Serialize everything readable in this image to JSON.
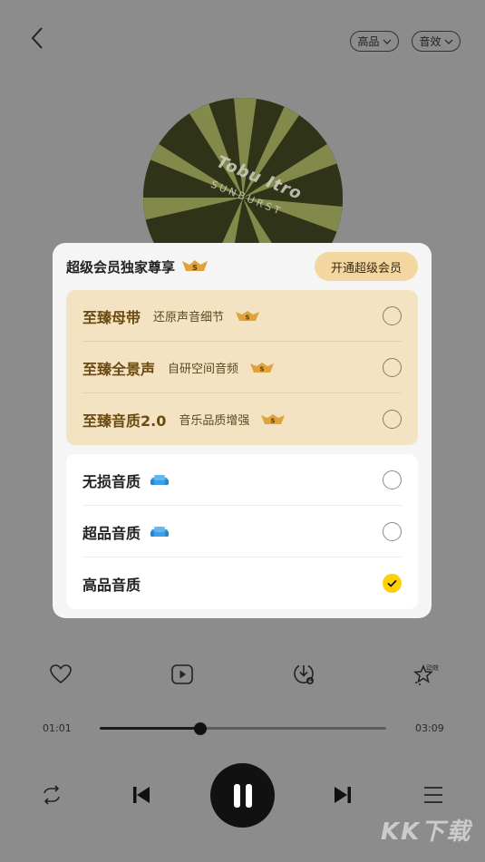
{
  "top_bar": {
    "back_icon": "chevron-left-icon",
    "quality_label": "高品",
    "effect_label": "音效"
  },
  "album": {
    "brand_text": "Tobu Itro",
    "sub_text": "SUNBURST"
  },
  "modal": {
    "title": "超级会员独家尊享",
    "title_badge": "super-vip-s-badge",
    "open_button": "开通超级会员",
    "premium_options": [
      {
        "name": "至臻母带",
        "desc": "还原声音细节",
        "badge": "super-vip-s-badge",
        "selected": false
      },
      {
        "name": "至臻全景声",
        "desc": "自研空间音频",
        "badge": "super-vip-s-badge",
        "selected": false
      },
      {
        "name": "至臻音质2.0",
        "desc": "音乐品质增强",
        "badge": "super-vip-s-badge",
        "selected": false
      }
    ],
    "normal_options": [
      {
        "name": "无损音质",
        "icon": "vip-sofa-icon",
        "selected": false
      },
      {
        "name": "超品音质",
        "icon": "vip-sofa-icon",
        "selected": false
      },
      {
        "name": "高品音质",
        "selected": true
      }
    ],
    "colors": {
      "premium_bg": "#f4e3c3",
      "accent_check": "#ffd100",
      "vip_button": "#f3d6a0"
    }
  },
  "actions": {
    "like_icon": "heart-icon",
    "video_icon": "play-video-icon",
    "download_icon": "download-icon",
    "effect_icon": "star-effect-icon",
    "effect_label": "动效"
  },
  "progress": {
    "current": "01:01",
    "total": "03:09",
    "fraction": 0.35
  },
  "controls": {
    "repeat_icon": "repeat-icon",
    "prev_icon": "skip-previous-icon",
    "pause_icon": "pause-icon",
    "next_icon": "skip-next-icon",
    "playlist_icon": "playlist-icon"
  },
  "watermark": "KK下载"
}
